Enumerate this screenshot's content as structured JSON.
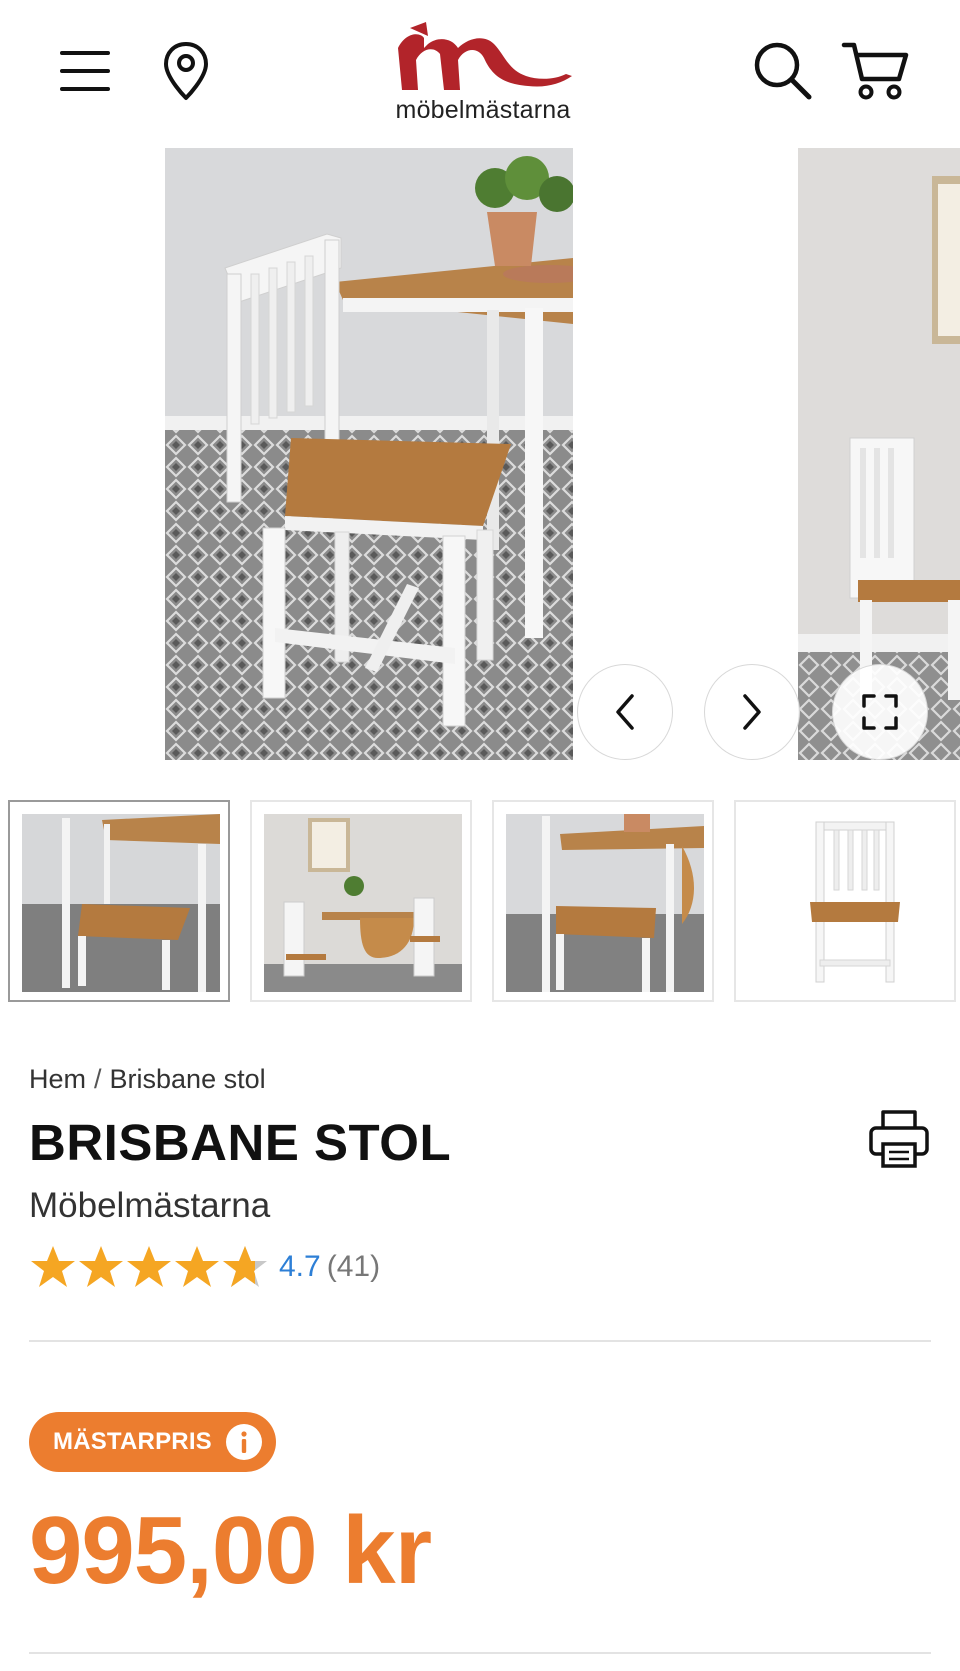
{
  "header": {
    "logo_text": "möbelmästarna",
    "brand_color": "#b2242a",
    "icons": [
      "menu-icon",
      "location-pin-icon",
      "search-icon",
      "cart-icon"
    ]
  },
  "gallery": {
    "prev_icon": "chevron-left-icon",
    "next_icon": "chevron-right-icon",
    "fullscreen_icon": "fullscreen-icon",
    "thumbnail_count": 4,
    "active_thumbnail": 1
  },
  "breadcrumb": {
    "home": "Hem",
    "separator": "/",
    "current": "Brisbane stol"
  },
  "product": {
    "title": "BRISBANE STOL",
    "brand": "Möbelmästarna",
    "rating_value": "4.7",
    "rating_count": "(41)",
    "rating_stars": 4.7,
    "badge_label": "MÄSTARPRIS",
    "price": "995,00 kr",
    "accent_color": "#ec7d2f",
    "rating_link_color": "#2d7fd6"
  }
}
